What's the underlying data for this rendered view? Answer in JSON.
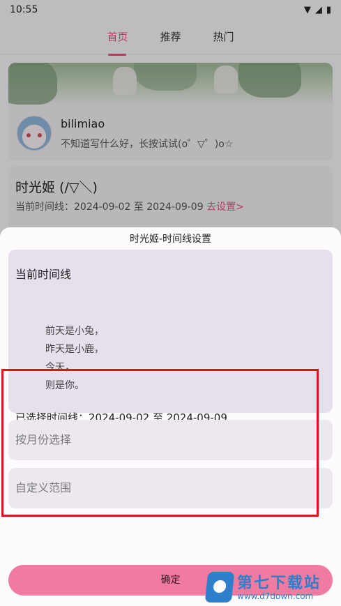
{
  "status_bar": {
    "time": "10:55"
  },
  "top_nav": {
    "tabs": [
      "首页",
      "推荐",
      "热门"
    ],
    "active_index": 0
  },
  "profile": {
    "name": "bilimiao",
    "signature": "不知道写什么好，长按试试(o゜▽゜)o☆"
  },
  "timeline_card": {
    "title": "时光姬 (/▽＼)",
    "range_prefix": "当前时间线：2024-09-02 至 2024-09-09",
    "range_link": "去设置>"
  },
  "sheet": {
    "title": "时光姬-时间线设置",
    "current_title": "当前时间线",
    "poem": [
      "前天是小兔，",
      "昨天是小鹿，",
      "今天，",
      "则是你。"
    ],
    "selected": "已选择时间线：2024-09-02 至 2024-09-09",
    "option_month": "按月份选择",
    "option_custom": "自定义范围",
    "confirm": "确定"
  },
  "watermark": {
    "brand": "第七下载站",
    "url": "www.d7down.com"
  },
  "colors": {
    "accent": "#e4507a",
    "confirm": "#f17aa0",
    "highlight": "#e01414",
    "watermark": "#2e7fc9"
  }
}
